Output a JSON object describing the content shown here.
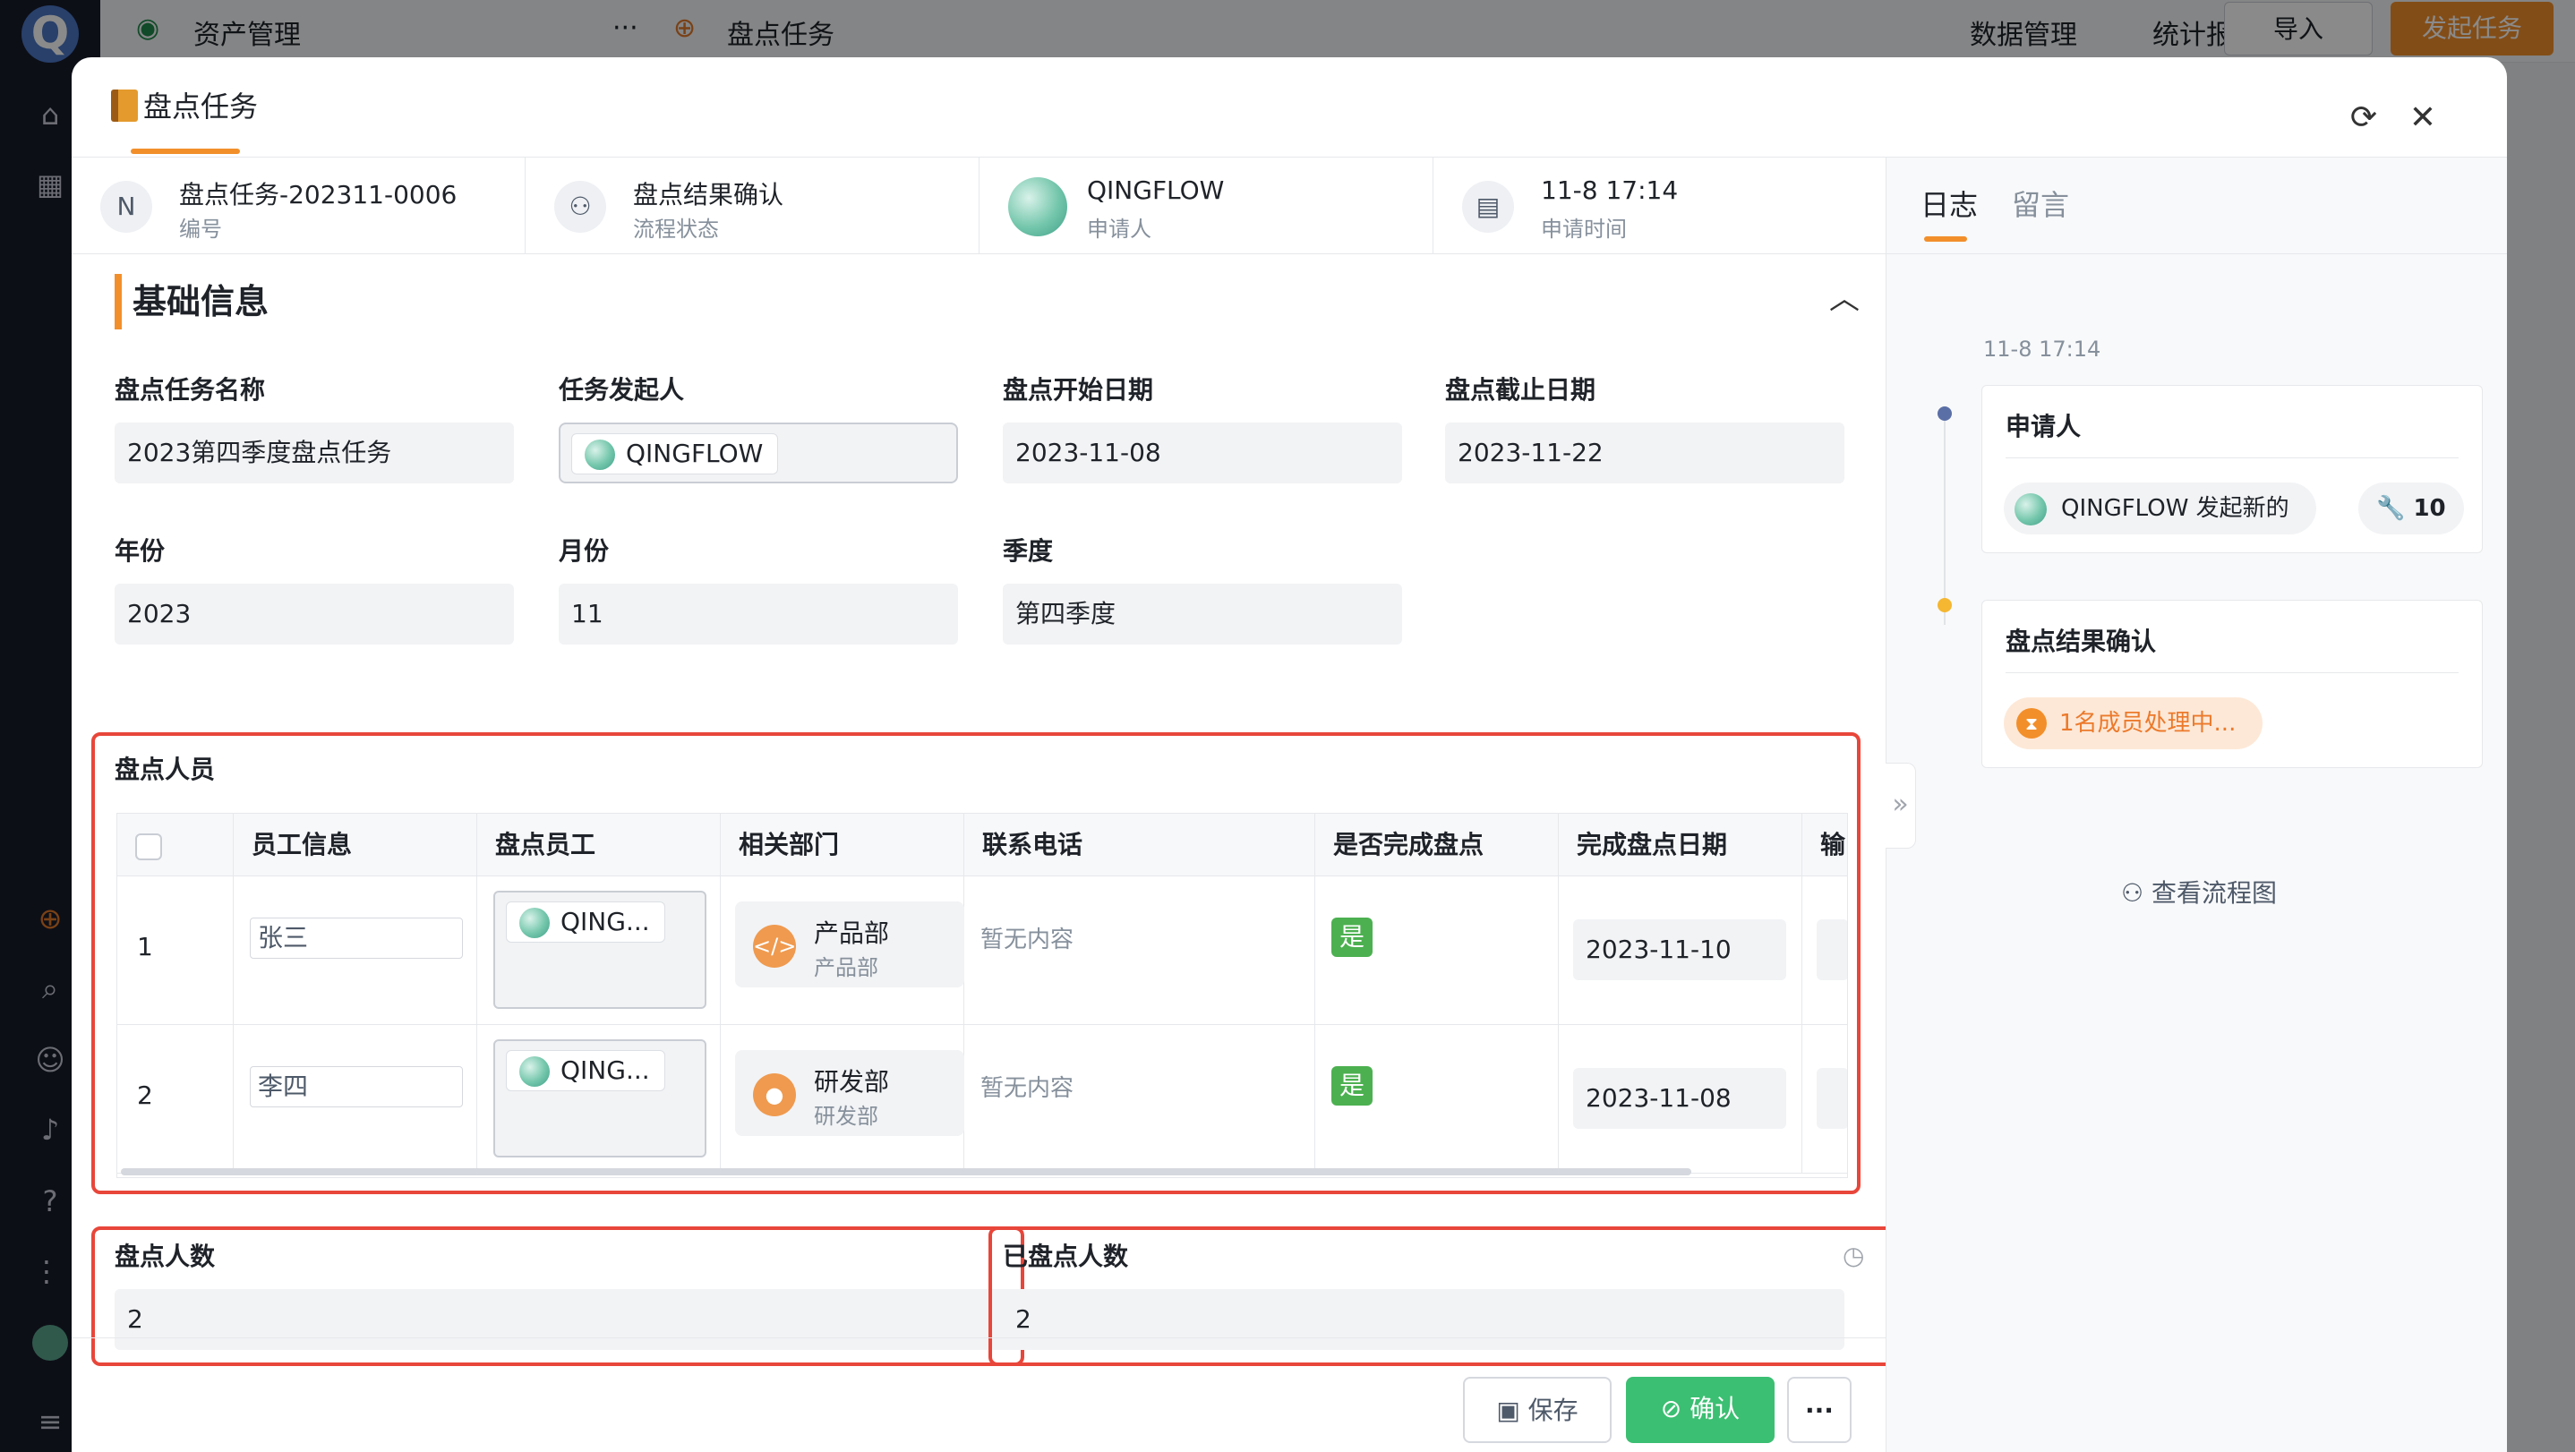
{
  "bg": {
    "app_title": "资产管理",
    "tab_title": "盘点任务",
    "data_mgmt": "数据管理",
    "reports": "统计报表",
    "import": "导入",
    "start_task": "发起任务"
  },
  "modal": {
    "title": "盘点任务"
  },
  "meta": [
    {
      "value": "盘点任务-202311-0006",
      "label": "编号"
    },
    {
      "value": "盘点结果确认",
      "label": "流程状态"
    },
    {
      "value": "QINGFLOW",
      "label": "申请人"
    },
    {
      "value": "11-8 17:14",
      "label": "申请时间"
    }
  ],
  "form": {
    "section_title": "基础信息",
    "fields": {
      "task_name": {
        "label": "盘点任务名称",
        "value": "2023第四季度盘点任务"
      },
      "initiator": {
        "label": "任务发起人",
        "value": "QINGFLOW"
      },
      "start_date": {
        "label": "盘点开始日期",
        "value": "2023-11-08"
      },
      "end_date": {
        "label": "盘点截止日期",
        "value": "2023-11-22"
      },
      "year": {
        "label": "年份",
        "value": "2023"
      },
      "month": {
        "label": "月份",
        "value": "11"
      },
      "quarter": {
        "label": "季度",
        "value": "第四季度"
      }
    },
    "staff_section_label": "盘点人员",
    "table": {
      "columns": [
        "员工信息",
        "盘点员工",
        "相关部门",
        "联系电话",
        "是否完成盘点",
        "完成盘点日期",
        "输"
      ],
      "rows": [
        {
          "no": "1",
          "name": "张三",
          "staff": "QING...",
          "dept": "产品部",
          "dept_sub": "产品部",
          "phone": "暂无内容",
          "done": "是",
          "done_date": "2023-11-10"
        },
        {
          "no": "2",
          "name": "李四",
          "staff": "QING...",
          "dept": "研发部",
          "dept_sub": "研发部",
          "phone": "暂无内容",
          "done": "是",
          "done_date": "2023-11-08"
        }
      ]
    },
    "count": {
      "label": "盘点人数",
      "value": "2"
    },
    "counted": {
      "label": "已盘点人数",
      "value": "2"
    }
  },
  "footer": {
    "save": "保存",
    "confirm": "确认",
    "more": "···"
  },
  "side": {
    "tabs": [
      "日志",
      "留言"
    ],
    "time": "11-8 17:14",
    "card1": {
      "title": "申请人",
      "user": "QINGFLOW 发起新的",
      "count": "10"
    },
    "card2": {
      "title": "盘点结果确认",
      "status": "1名成员处理中..."
    },
    "flow_link": "查看流程图"
  },
  "colors": {
    "accent": "#f28f2b",
    "confirm": "#3bbf72",
    "highlight": "#e8463a",
    "yes": "#4cb050"
  }
}
